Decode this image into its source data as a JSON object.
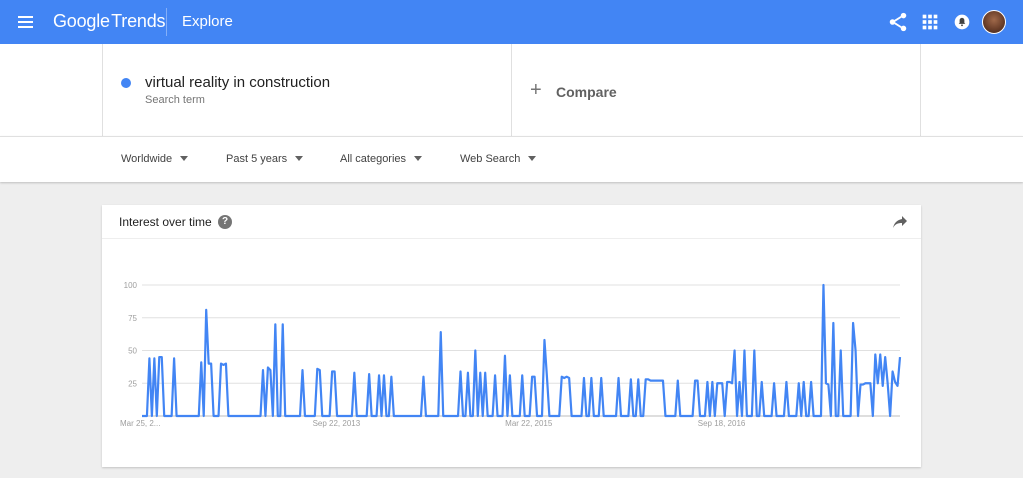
{
  "header": {
    "logo_google": "Google",
    "logo_trends": "Trends",
    "section": "Explore",
    "icons": [
      "menu-icon",
      "share-icon",
      "apps-icon",
      "notifications-icon",
      "avatar"
    ],
    "brand_color": "#4285f4"
  },
  "search": {
    "term": "virtual reality in construction",
    "term_type": "Search term",
    "term_color": "#4285f4",
    "compare_label": "Compare"
  },
  "filters": {
    "region": "Worldwide",
    "time": "Past 5 years",
    "category": "All categories",
    "search_type": "Web Search"
  },
  "card": {
    "title": "Interest over time",
    "help_icon": "help-icon",
    "share_icon": "share-arrow-icon"
  },
  "chart_data": {
    "type": "line",
    "series_color": "#4285f4",
    "ylim": [
      0,
      100
    ],
    "y_ticks": [
      "100",
      "75",
      "50",
      "25"
    ],
    "x_ticks": [
      "Mar 25, 2...",
      "Sep 22, 2013",
      "Mar 22, 2015",
      "Sep 18, 2016"
    ],
    "grid": true,
    "series": [
      {
        "values": [
          0,
          0,
          0,
          44,
          0,
          44,
          0,
          45,
          45,
          0,
          0,
          0,
          0,
          44,
          0,
          0,
          0,
          0,
          0,
          0,
          0,
          0,
          0,
          0,
          41,
          0,
          81,
          40,
          40,
          0,
          0,
          0,
          40,
          39,
          40,
          0,
          0,
          0,
          0,
          0,
          0,
          0,
          0,
          0,
          0,
          0,
          0,
          0,
          0,
          35,
          0,
          37,
          35,
          0,
          70,
          0,
          0,
          70,
          0,
          0,
          0,
          0,
          0,
          0,
          0,
          35,
          0,
          0,
          0,
          0,
          0,
          36,
          35,
          0,
          0,
          0,
          0,
          34,
          34,
          0,
          0,
          0,
          0,
          0,
          0,
          0,
          33,
          0,
          0,
          0,
          0,
          0,
          32,
          0,
          0,
          0,
          31,
          0,
          31,
          0,
          0,
          30,
          0,
          0,
          0,
          0,
          0,
          0,
          0,
          0,
          0,
          0,
          0,
          0,
          30,
          0,
          0,
          0,
          0,
          0,
          0,
          64,
          0,
          0,
          0,
          0,
          0,
          0,
          0,
          34,
          0,
          0,
          33,
          0,
          0,
          50,
          0,
          33,
          0,
          33,
          0,
          0,
          0,
          31,
          0,
          0,
          0,
          46,
          0,
          31,
          0,
          0,
          0,
          0,
          31,
          0,
          0,
          0,
          30,
          30,
          0,
          0,
          0,
          58,
          30,
          0,
          0,
          0,
          0,
          0,
          30,
          29,
          30,
          29,
          0,
          0,
          0,
          0,
          0,
          29,
          0,
          0,
          29,
          0,
          0,
          0,
          29,
          0,
          0,
          0,
          0,
          0,
          0,
          29,
          0,
          0,
          0,
          0,
          28,
          0,
          0,
          28,
          0,
          0,
          28,
          28,
          27,
          27,
          27,
          27,
          27,
          27,
          0,
          0,
          0,
          0,
          0,
          27,
          0,
          0,
          0,
          0,
          0,
          0,
          27,
          27,
          0,
          0,
          0,
          26,
          0,
          26,
          0,
          25,
          25,
          25,
          0,
          26,
          26,
          25,
          50,
          0,
          26,
          0,
          50,
          0,
          0,
          0,
          50,
          0,
          0,
          26,
          0,
          0,
          0,
          0,
          25,
          0,
          0,
          0,
          0,
          26,
          0,
          0,
          0,
          0,
          25,
          0,
          26,
          0,
          0,
          26,
          0,
          0,
          0,
          0,
          100,
          25,
          24,
          0,
          71,
          0,
          0,
          50,
          0,
          0,
          0,
          0,
          71,
          50,
          0,
          24,
          24,
          25,
          25,
          25,
          0,
          47,
          25,
          47,
          23,
          45,
          25,
          0,
          34,
          26,
          23,
          45
        ],
        "x_tick_indices": [
          0,
          78,
          156,
          234
        ]
      }
    ]
  }
}
